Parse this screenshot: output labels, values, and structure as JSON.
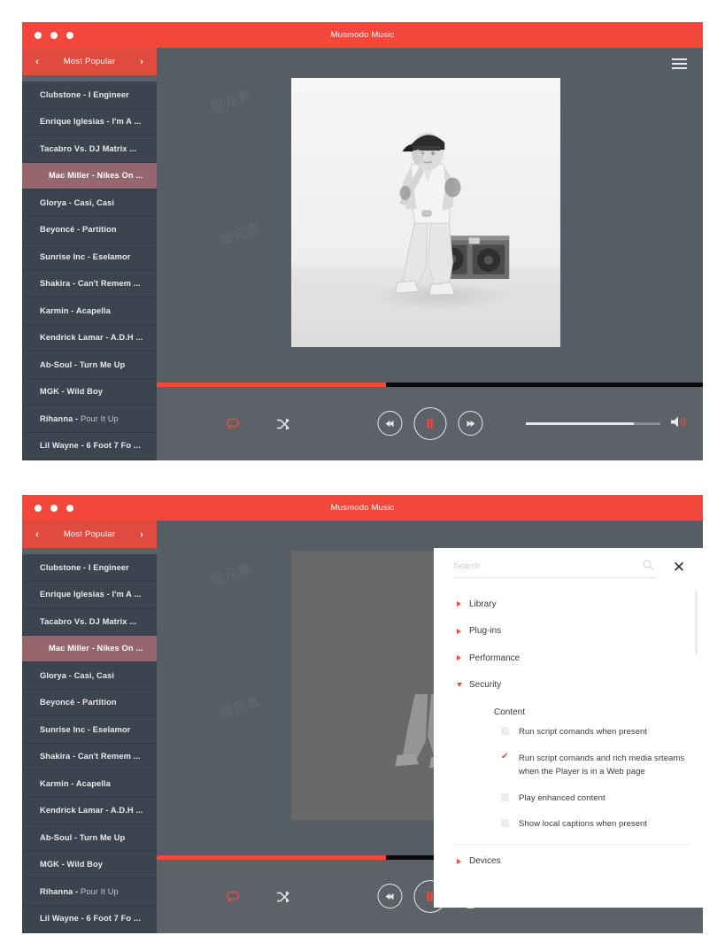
{
  "window": {
    "title": "Musmodo Music",
    "traffic_lights": [
      "close",
      "minimize",
      "maximize"
    ]
  },
  "sidebar": {
    "nav": {
      "title": "Most Popular",
      "prev_icon": "chevron-left-icon",
      "next_icon": "chevron-right-icon"
    },
    "tracks": [
      {
        "label": "Clubstone - I Engineer",
        "active": false
      },
      {
        "label": "Enrique Iglesias - I'm A ...",
        "active": false
      },
      {
        "label": "Tacabro Vs. DJ Matrix ...",
        "active": false
      },
      {
        "label": "Mac Miller - Nikes On ...",
        "active": true
      },
      {
        "label": "Glorya - Casi, Casi",
        "active": false
      },
      {
        "label": "Beyoncé - Partition",
        "active": false
      },
      {
        "label": "Sunrise Inc - Eselamor",
        "active": false
      },
      {
        "label": "Shakira - Can't Remem ...",
        "active": false
      },
      {
        "label": "Karmin - Acapella",
        "active": false
      },
      {
        "label": "Kendrick Lamar - A.D.H ...",
        "active": false
      },
      {
        "label": "Ab-Soul - Turn Me Up",
        "active": false
      },
      {
        "label": "MGK - Wild Boy",
        "active": false
      },
      {
        "label": "Rihanna - Pour It Up",
        "active": false
      },
      {
        "label": "Lil Wayne - 6 Foot 7 Fo ...",
        "active": false
      }
    ]
  },
  "player": {
    "menu_icon": "hamburger-menu-icon",
    "album_art_alt": "Mac Miller album cover - person in cap seated on boombox",
    "progress_percent": 42,
    "volume_percent": 80,
    "repeat_icon": "repeat-icon",
    "shuffle_icon": "shuffle-icon",
    "previous_icon": "previous-track-icon",
    "play_pause_icon": "pause-icon",
    "next_icon": "next-track-icon",
    "speaker_icon": "volume-speaker-icon"
  },
  "settings_panel": {
    "search": {
      "placeholder": "Search",
      "value": "",
      "icon": "search-icon"
    },
    "close_icon": "close-icon",
    "close_label": "✕",
    "tree": [
      {
        "label": "Library",
        "expanded": false
      },
      {
        "label": "Plug-ins",
        "expanded": false
      },
      {
        "label": "Performance",
        "expanded": false
      },
      {
        "label": "Security",
        "expanded": true
      }
    ],
    "security_group": "Content",
    "options": [
      {
        "label": "Run script comands when present",
        "checked": false
      },
      {
        "label": "Run script comands and rich media srteams when the Player is in a Web page",
        "checked": true
      },
      {
        "label": "Play enhanced content",
        "checked": false
      },
      {
        "label": "Show local captions when present",
        "checked": false
      }
    ],
    "trailing_tree": [
      {
        "label": "Devices",
        "expanded": false
      }
    ]
  },
  "colors": {
    "brand_red": "#f4473c",
    "nav_red": "#e04b40",
    "sidebar_bg": "#3c4450",
    "active_track": "#96666f",
    "stage_bg": "#565d65",
    "controls_bg": "#5c6268",
    "panel_bg": "#ffffff"
  }
}
